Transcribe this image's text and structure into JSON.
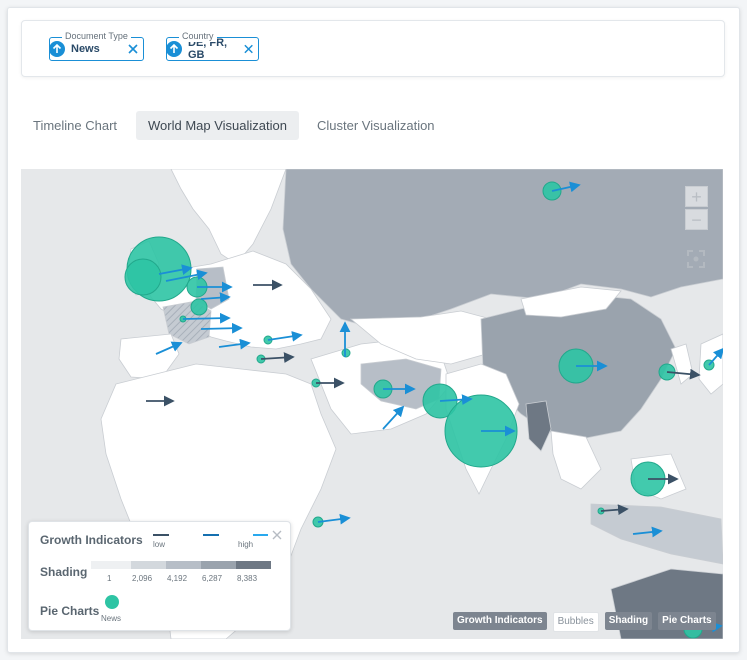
{
  "filters": [
    {
      "label": "Document Type",
      "value": "News"
    },
    {
      "label": "Country",
      "value": "DE, FR, GB"
    }
  ],
  "tabs": [
    {
      "label": "Timeline Chart",
      "active": false
    },
    {
      "label": "World Map Visualization",
      "active": true
    },
    {
      "label": "Cluster Visualization",
      "active": false
    }
  ],
  "map": {
    "zoom_in": "+",
    "zoom_out": "−",
    "colors": {
      "land": "#ffffff",
      "shade_light": "#b7bec7",
      "shade_mid": "#9aa3ad",
      "shade_dark": "#6e7884",
      "bubble": "#2ec4a4",
      "arrow": "#1a8fd6"
    }
  },
  "legend": {
    "growth_title": "Growth Indicators",
    "growth_low": "low",
    "growth_high": "high",
    "shading_title": "Shading",
    "shading_values": [
      "1",
      "2,096",
      "4,192",
      "6,287",
      "8,383"
    ],
    "pie_title": "Pie Charts",
    "pie_item": "News"
  },
  "map_buttons": [
    {
      "label": "Growth Indicators",
      "active": true
    },
    {
      "label": "Bubbles",
      "active": false
    },
    {
      "label": "Shading",
      "active": true
    },
    {
      "label": "Pie Charts",
      "active": true
    }
  ]
}
